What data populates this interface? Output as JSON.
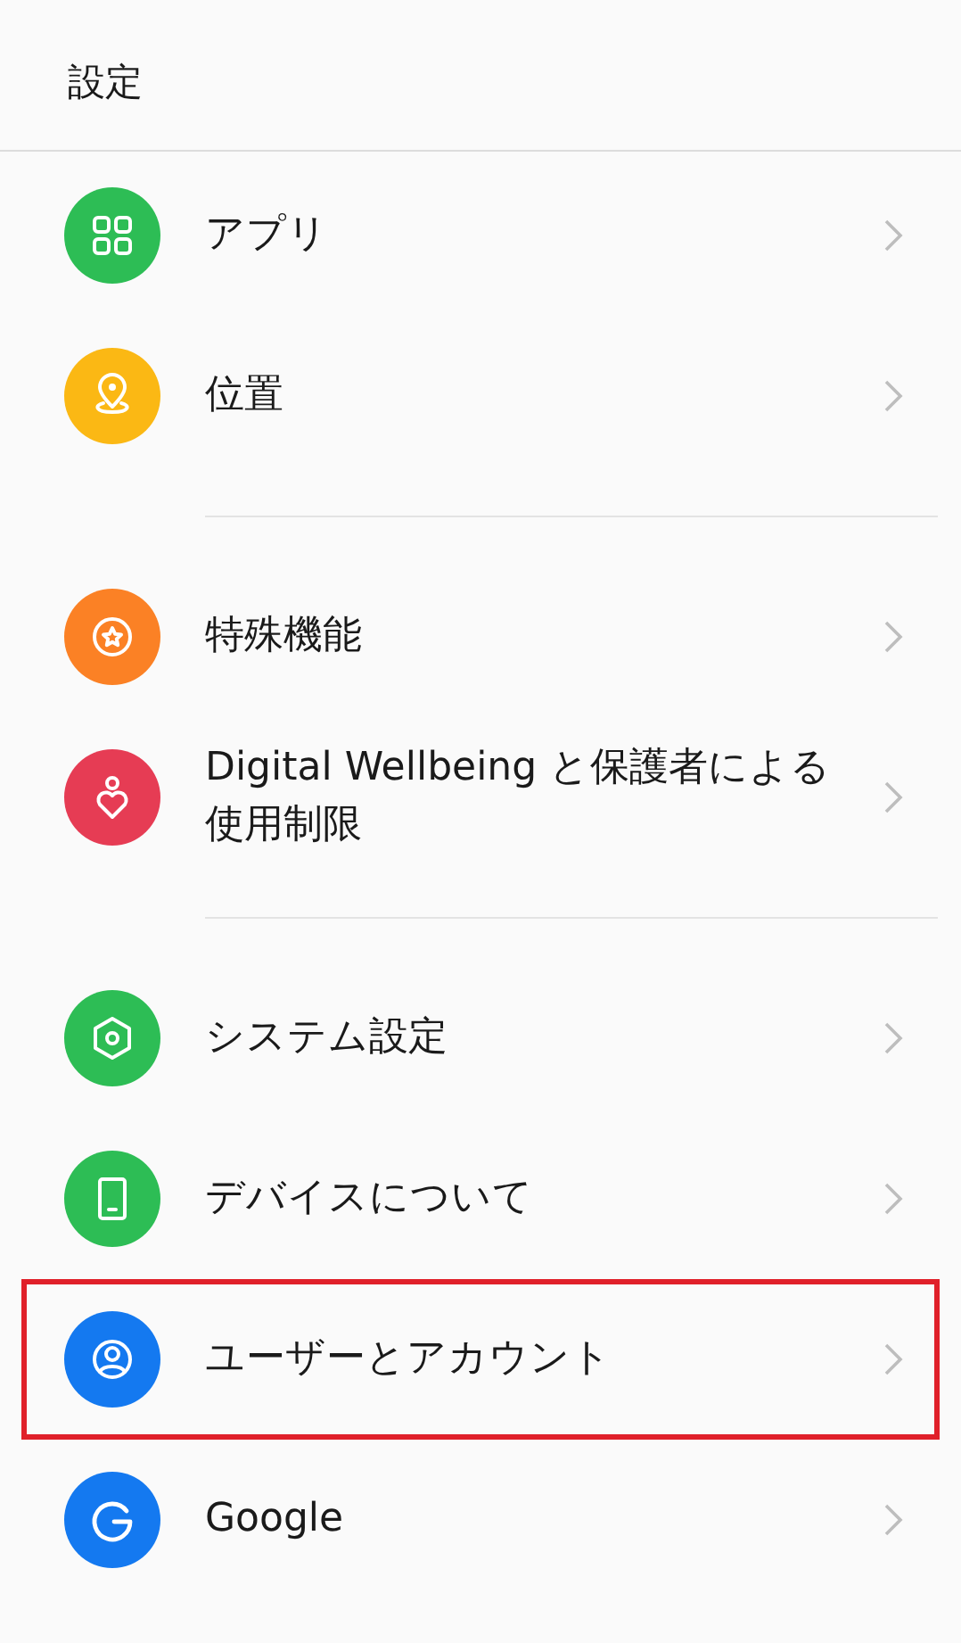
{
  "title": "設定",
  "groups": [
    {
      "items": [
        {
          "label": "アプリ",
          "kind": "apps",
          "color": "#2dbd55",
          "highlighted": false
        },
        {
          "label": "位置",
          "kind": "location",
          "color": "#fbb814",
          "highlighted": false
        }
      ]
    },
    {
      "items": [
        {
          "label": "特殊機能",
          "kind": "star",
          "color": "#fb8125",
          "highlighted": false
        },
        {
          "label": "Digital Wellbeing と保護者による使用制限",
          "kind": "heart",
          "color": "#e63c54",
          "highlighted": false
        }
      ]
    },
    {
      "items": [
        {
          "label": "システム設定",
          "kind": "hexagon",
          "color": "#2dbd55",
          "highlighted": false
        },
        {
          "label": "デバイスについて",
          "kind": "phone",
          "color": "#2dbd55",
          "highlighted": false
        },
        {
          "label": "ユーザーとアカウント",
          "kind": "user",
          "color": "#1479f0",
          "highlighted": true
        },
        {
          "label": "Google",
          "kind": "g",
          "color": "#1479f0",
          "highlighted": false
        }
      ]
    }
  ]
}
